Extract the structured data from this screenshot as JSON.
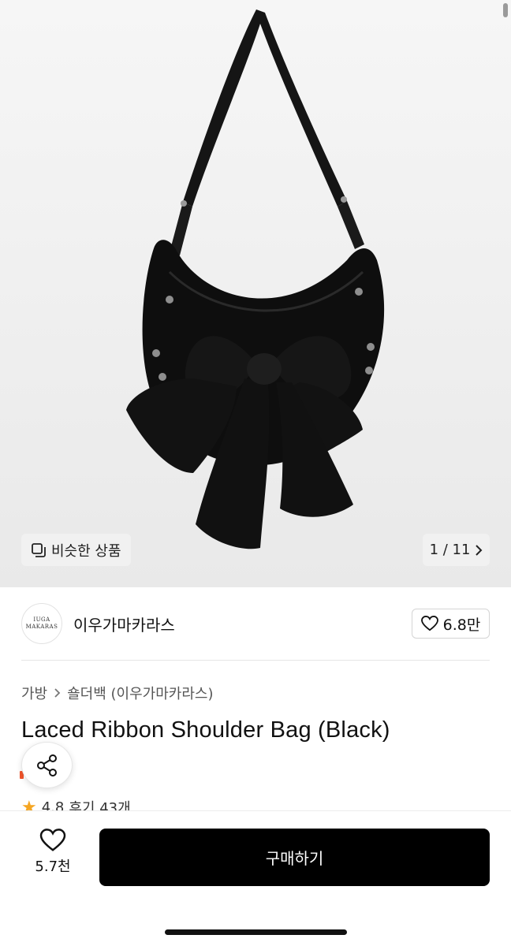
{
  "gallery": {
    "similar_label": "비슷한 상품",
    "counter": "1 / 11",
    "similar_icon": "similar-items-icon",
    "next_icon": "chevron-right-icon"
  },
  "brand": {
    "logo_line1": "IUGA",
    "logo_line2": "MAKARAS",
    "name": "이우가마카라스",
    "like_count": "6.8만",
    "like_icon": "heart-icon"
  },
  "breadcrumb": {
    "items": [
      "가방",
      "숄더백 (이우가마카라스)"
    ],
    "separator_icon": "chevron-right-icon"
  },
  "product": {
    "title": "Laced Ribbon Shoulder Bag (Black)"
  },
  "rating": {
    "score": "4.8",
    "reviews": "후기 43개"
  },
  "bottom_bar": {
    "wish_count": "5.7천",
    "buy_label": "구매하기"
  },
  "colors": {
    "accent_star": "#f5a623",
    "buy_button": "#000000",
    "orange_tag": "#f2552c"
  }
}
